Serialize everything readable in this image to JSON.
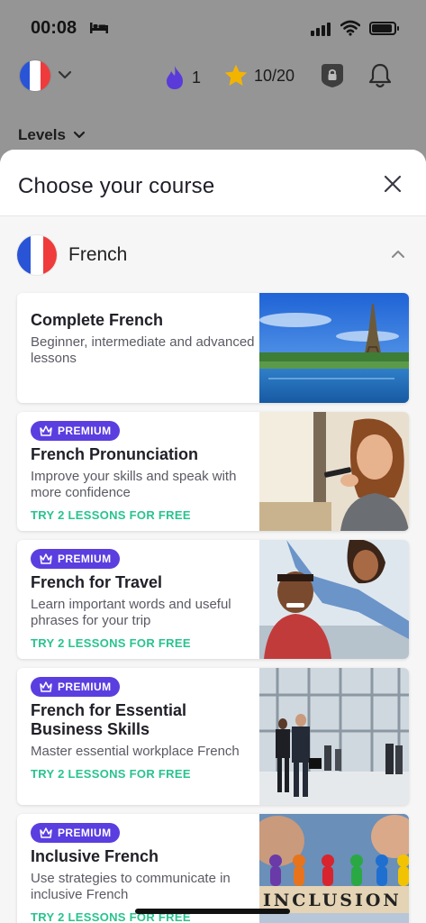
{
  "status": {
    "time": "00:08"
  },
  "topbar": {
    "streak_count": "1",
    "stars": "10/20"
  },
  "levels": {
    "label": "Levels"
  },
  "sheet": {
    "title": "Choose your course",
    "language": {
      "name": "French"
    },
    "courses": [
      {
        "title": "Complete French",
        "description": "Beginner, intermediate and advanced lessons",
        "image": "eiffel-tower-photo"
      },
      {
        "badge": "PREMIUM",
        "title": "French Pronunciation",
        "description": "Improve your skills and speak with more confidence",
        "cta": "TRY 2 LESSONS FOR FREE",
        "image": "woman-speaking-phone-photo"
      },
      {
        "badge": "PREMIUM",
        "title": "French for Travel",
        "description": "Learn important words and useful phrases for your trip",
        "cta": "TRY 2 LESSONS FOR FREE",
        "image": "travel-couple-photo"
      },
      {
        "badge": "PREMIUM",
        "title": "French for Essential Business Skills",
        "description": "Master essential workplace French",
        "cta": "TRY 2 LESSONS FOR FREE",
        "image": "business-people-photo"
      },
      {
        "badge": "PREMIUM",
        "title": "Inclusive French",
        "description": "Use strategies to communicate in inclusive French",
        "cta": "TRY 2 LESSONS FOR FREE",
        "image": "inclusion-blocks-photo",
        "image_text": "INCLUSION"
      }
    ]
  },
  "colors": {
    "premium": "#5b3ee0",
    "cta": "#29c38f",
    "flag_blue": "#2a54d6",
    "flag_red": "#ef3b3b",
    "star": "#f3b400",
    "streak": "#5a3ad9"
  }
}
